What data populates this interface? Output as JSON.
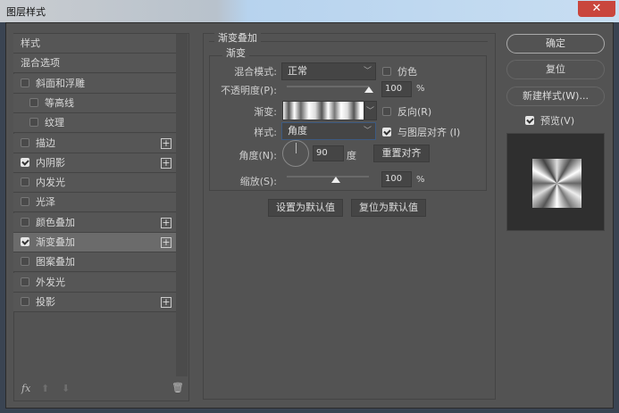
{
  "window": {
    "title": "图层样式",
    "close": "✕"
  },
  "sidebar": {
    "items": [
      {
        "label": "样式",
        "checkbox": null
      },
      {
        "label": "混合选项",
        "checkbox": null
      },
      {
        "label": "斜面和浮雕",
        "checkbox": false
      },
      {
        "label": "等高线",
        "checkbox": false,
        "indent": true
      },
      {
        "label": "纹理",
        "checkbox": false,
        "indent": true
      },
      {
        "label": "描边",
        "checkbox": false,
        "plus": true
      },
      {
        "label": "内阴影",
        "checkbox": true,
        "plus": true
      },
      {
        "label": "内发光",
        "checkbox": false
      },
      {
        "label": "光泽",
        "checkbox": false
      },
      {
        "label": "颜色叠加",
        "checkbox": false,
        "plus": true
      },
      {
        "label": "渐变叠加",
        "checkbox": true,
        "plus": true,
        "selected": true
      },
      {
        "label": "图案叠加",
        "checkbox": false
      },
      {
        "label": "外发光",
        "checkbox": false
      },
      {
        "label": "投影",
        "checkbox": false,
        "plus": true
      }
    ],
    "footer": {
      "fx": "fx",
      "up": "⬆",
      "down": "⬇",
      "trash": "🗑"
    }
  },
  "panel": {
    "group_title": "渐变叠加",
    "sub_title": "渐变",
    "blend_mode_label": "混合模式:",
    "blend_mode": "正常",
    "dither_label": "仿色",
    "opacity_label": "不透明度(P):",
    "opacity": "100",
    "opacity_value": 100,
    "percent": "%",
    "gradient_label": "渐变:",
    "reverse_label": "反向(R)",
    "style_label": "样式:",
    "style": "角度",
    "align_label": "与图层对齐 (I)",
    "angle_label": "角度(N):",
    "angle": "90",
    "degree": "度",
    "reset_align": "重置对齐",
    "scale_label": "缩放(S):",
    "scale": "100",
    "scale_value": 100,
    "set_default": "设置为默认值",
    "reset_default": "复位为默认值"
  },
  "right": {
    "ok": "确定",
    "reset": "复位",
    "new_style": "新建样式(W)...",
    "preview_label": "预览(V)",
    "preview_checked": true
  }
}
